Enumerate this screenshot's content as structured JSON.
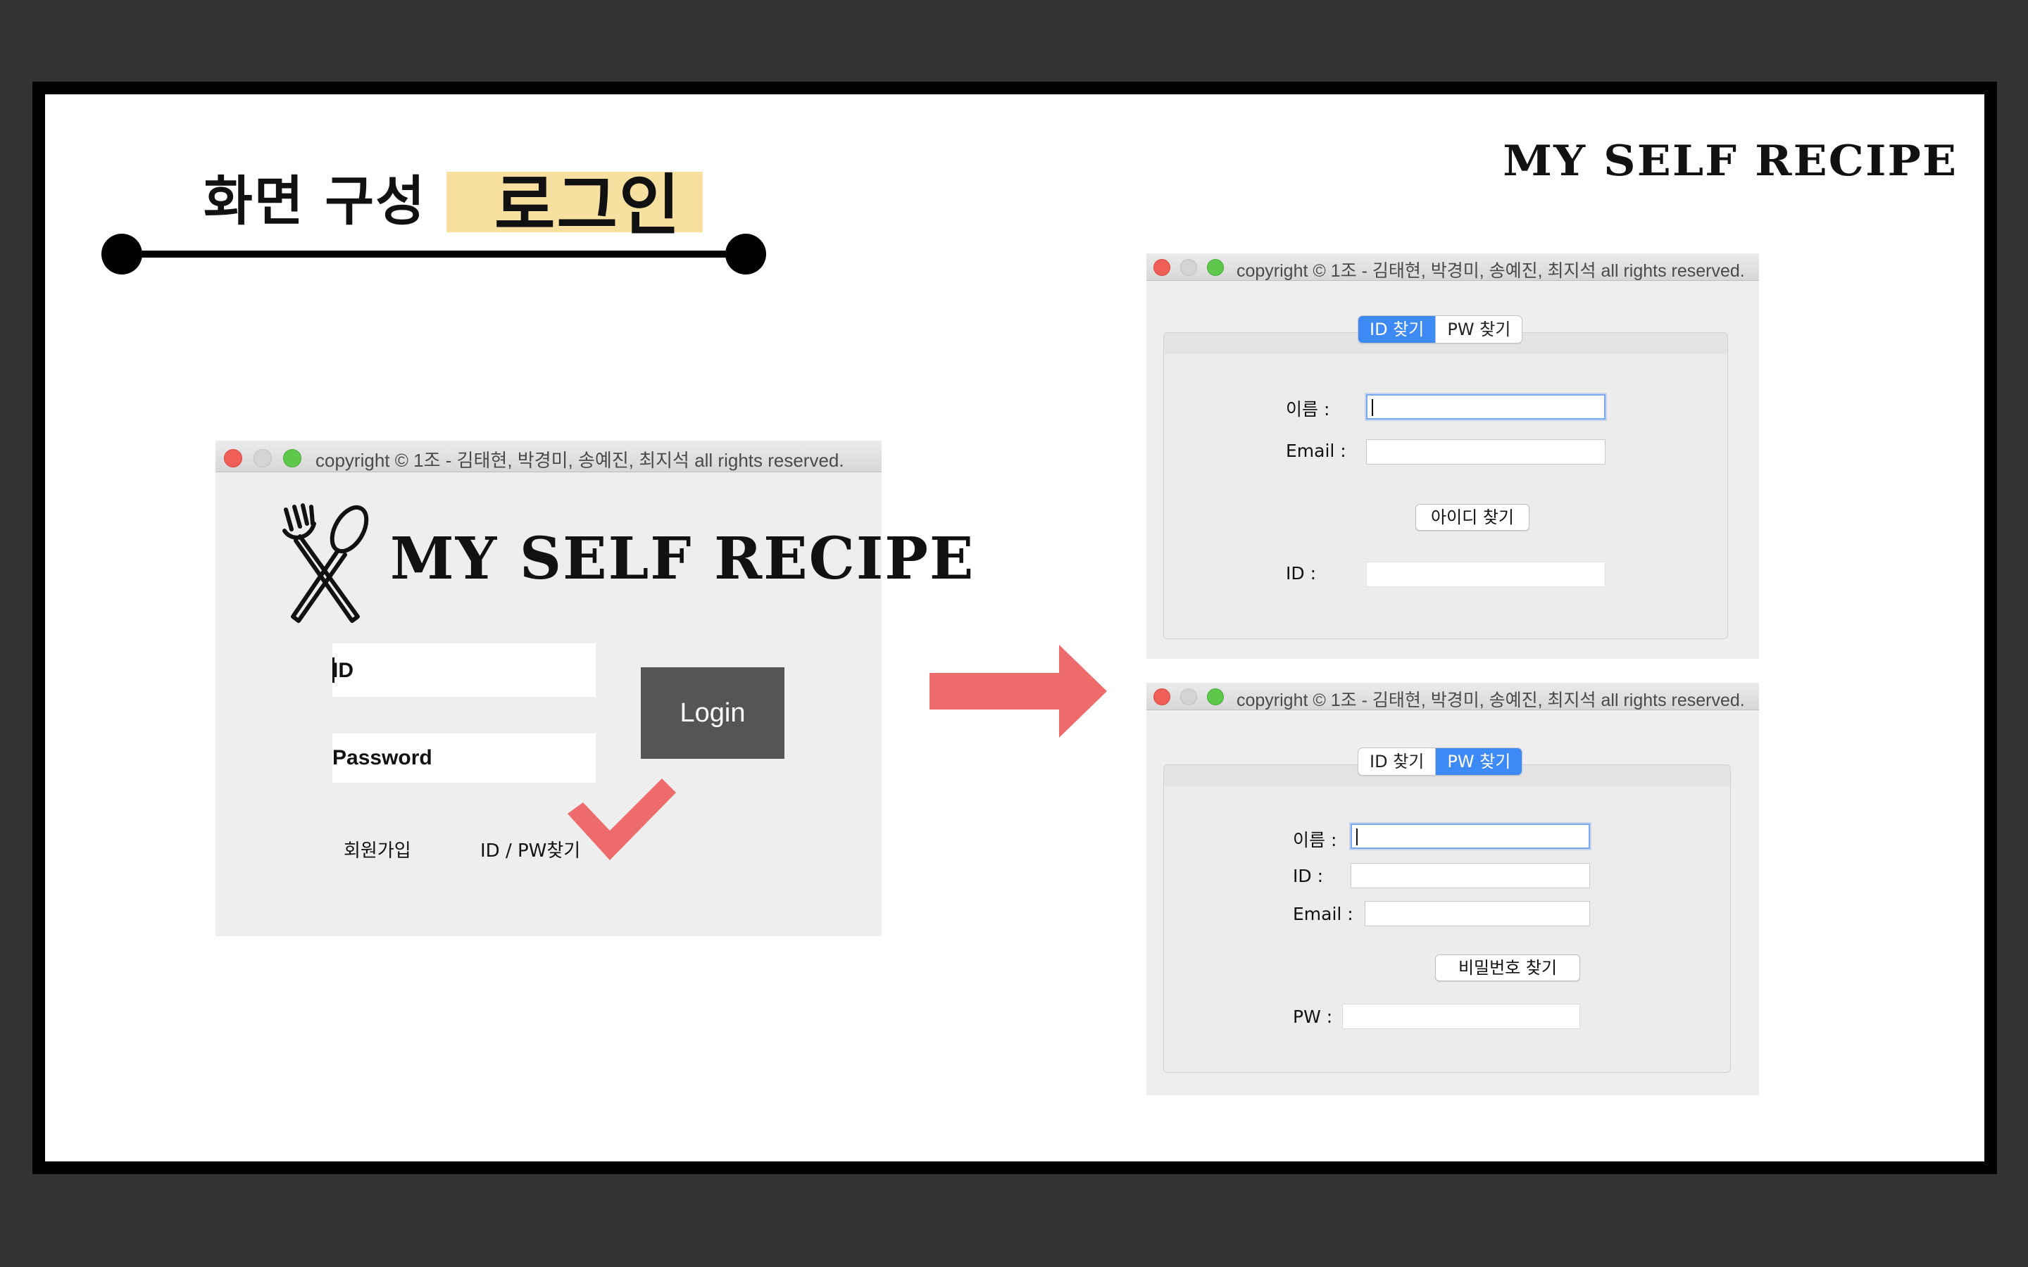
{
  "slide": {
    "heading": "화면 구성",
    "subheading": "로그인",
    "brand": "MY SELF RECIPE"
  },
  "login_window": {
    "title": "copyright © 1조 - 김태현, 박경미, 송예진, 최지석 all rights reserved.",
    "logo_text": "MY SELF RECIPE",
    "id_label": "ID",
    "password_label": "Password",
    "login_button": "Login",
    "signup_link": "회원가입",
    "find_link": "ID  /  PW찾기"
  },
  "find_id_window": {
    "title": "copyright © 1조 - 김태현, 박경미, 송예진, 최지석 all rights reserved.",
    "tabs": [
      "ID 찾기",
      "PW 찾기"
    ],
    "active_tab": "ID 찾기",
    "name_label": "이름 :",
    "email_label": "Email :",
    "find_button": "아이디 찾기",
    "result_label": "ID :"
  },
  "find_pw_window": {
    "title": "copyright © 1조 - 김태현, 박경미, 송예진, 최지석 all rights reserved.",
    "tabs": [
      "ID 찾기",
      "PW 찾기"
    ],
    "active_tab": "PW 찾기",
    "name_label": "이름 :",
    "id_label": "ID :",
    "email_label": "Email :",
    "find_button": "비밀번호 찾기",
    "result_label": "PW :"
  },
  "colors": {
    "highlight": "#f8e0a0",
    "arrow": "#ee6b6b",
    "checkmark": "#ee6b6b",
    "tab_active": "#3d8af7",
    "login_button": "#555555"
  },
  "icons": [
    "fork-spoon-icon",
    "arrow-right-icon",
    "checkmark-icon"
  ]
}
